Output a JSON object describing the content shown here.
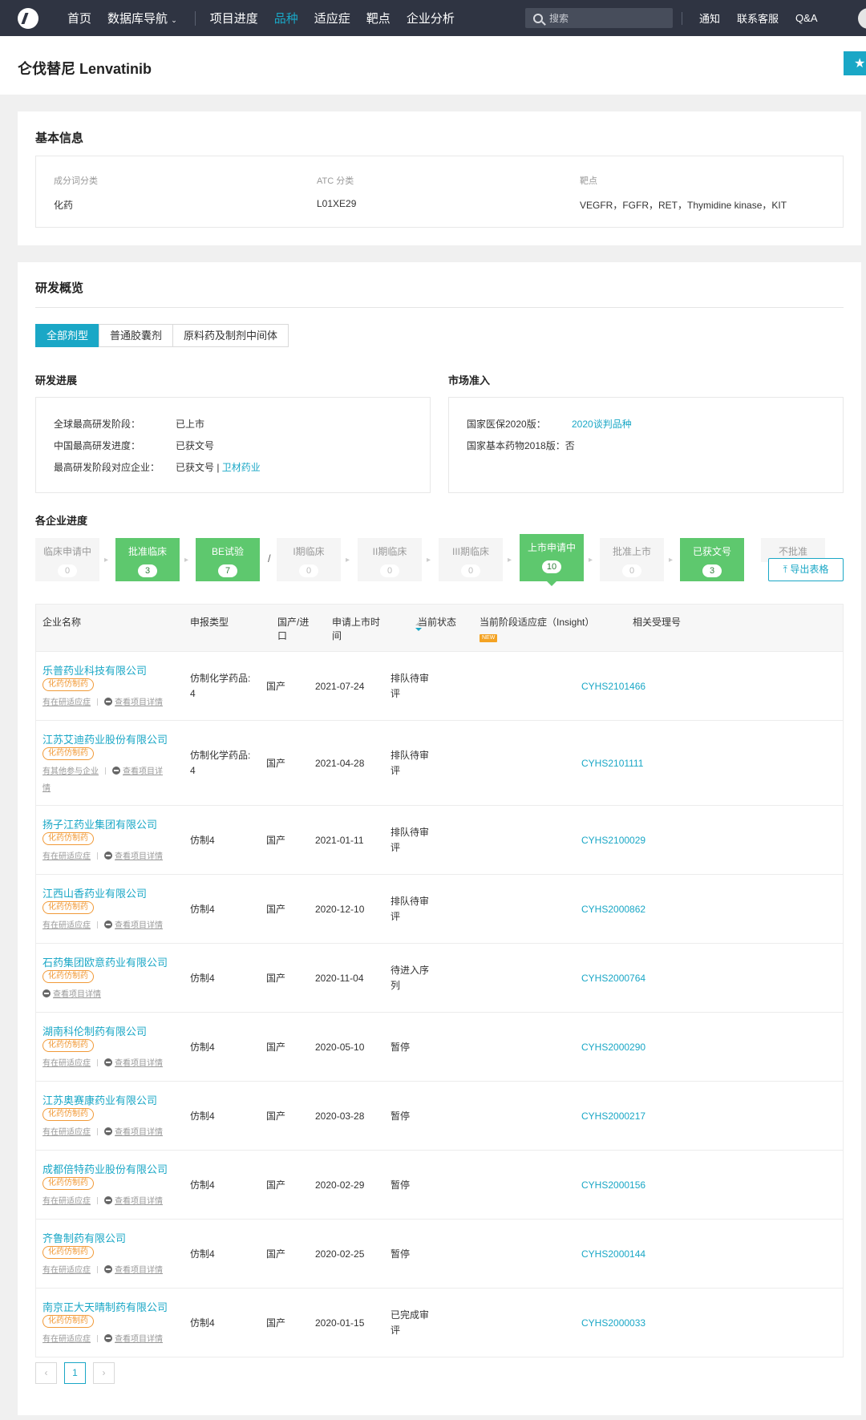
{
  "nav": {
    "items": [
      "首页",
      "数据库导航",
      "项目进度",
      "品种",
      "适应症",
      "靶点",
      "企业分析"
    ],
    "active_index": 3,
    "search_placeholder": "搜索",
    "right": [
      "通知",
      "联系客服",
      "Q&A"
    ]
  },
  "page": {
    "title": "仑伐替尼 Lenvatinib"
  },
  "basic": {
    "title": "基本信息",
    "fields": [
      {
        "label": "成分词分类",
        "value": "化药"
      },
      {
        "label": "ATC 分类",
        "value": "L01XE29"
      },
      {
        "label": "靶点",
        "value": "VEGFR，FGFR，RET，Thymidine kinase，KIT"
      }
    ]
  },
  "overview": {
    "title": "研发概览",
    "tabs": [
      "全部剂型",
      "普通胶囊剂",
      "原料药及制剂中间体"
    ],
    "active_tab": 0,
    "progress": {
      "title": "研发进展",
      "rows": [
        {
          "label": "全球最高研发阶段：",
          "value": "已上市",
          "link": ""
        },
        {
          "label": "中国最高研发进度：",
          "value": "已获文号",
          "link": ""
        },
        {
          "label": "最高研发阶段对应企业：",
          "value": "已获文号 | ",
          "link": "卫材药业"
        }
      ]
    },
    "market": {
      "title": "市场准入",
      "rows": [
        {
          "label": "国家医保2020版：",
          "value": "",
          "link": "2020谈判品种"
        },
        {
          "label": "国家基本药物2018版：",
          "value": "否",
          "link": ""
        }
      ]
    }
  },
  "pipeline": {
    "title": "各企业进度",
    "stages": [
      {
        "label": "临床申请中",
        "count": "0",
        "on": false
      },
      {
        "label": "批准临床",
        "count": "3",
        "on": true
      },
      {
        "label": "BE试验",
        "count": "7",
        "on": true
      },
      {
        "label": "I期临床",
        "count": "0",
        "on": false
      },
      {
        "label": "II期临床",
        "count": "0",
        "on": false
      },
      {
        "label": "III期临床",
        "count": "0",
        "on": false
      },
      {
        "label": "上市申请中",
        "count": "10",
        "on": true
      },
      {
        "label": "批准上市",
        "count": "0",
        "on": false
      },
      {
        "label": "已获文号",
        "count": "3",
        "on": true
      },
      {
        "label": "不批准",
        "count": "",
        "on": false
      }
    ],
    "slash": "/",
    "export_label": "导出表格"
  },
  "table": {
    "headers": [
      "企业名称",
      "申报类型",
      "国产/进口",
      "申请上市时间",
      "当前状态",
      "当前阶段适应症（Insight）",
      "相关受理号"
    ],
    "new_badge": "NEW",
    "rows": [
      {
        "company": "乐普药业科技有限公司",
        "tag": "化药仿制药",
        "link1": "有在研适应症",
        "link2": "查看项目详情",
        "type": "仿制化学药品:\n4",
        "origin": "国产",
        "date": "2021-07-24",
        "status": "排队待审\n评",
        "indication": "",
        "number": "CYHS2101466"
      },
      {
        "company": "江苏艾迪药业股份有限公司",
        "tag": "化药仿制药",
        "link1": "有其他参与企业",
        "link2": "查看项目详",
        "link3": "情",
        "type": "仿制化学药品:\n4",
        "origin": "国产",
        "date": "2021-04-28",
        "status": "排队待审\n评",
        "indication": "",
        "number": "CYHS2101111"
      },
      {
        "company": "扬子江药业集团有限公司",
        "tag": "化药仿制药",
        "link1": "有在研适应症",
        "link2": "查看项目详情",
        "type": "仿制4",
        "origin": "国产",
        "date": "2021-01-11",
        "status": "排队待审\n评",
        "indication": "",
        "number": "CYHS2100029"
      },
      {
        "company": "江西山香药业有限公司",
        "tag": "化药仿制药",
        "link1": "有在研适应症",
        "link2": "查看项目详情",
        "type": "仿制4",
        "origin": "国产",
        "date": "2020-12-10",
        "status": "排队待审\n评",
        "indication": "",
        "number": "CYHS2000862"
      },
      {
        "company": "石药集团欧意药业有限公司",
        "tag": "化药仿制药",
        "link1": "",
        "link2": "查看项目详情",
        "type": "仿制4",
        "origin": "国产",
        "date": "2020-11-04",
        "status": "待进入序\n列",
        "indication": "",
        "number": "CYHS2000764"
      },
      {
        "company": "湖南科伦制药有限公司",
        "tag": "化药仿制药",
        "link1": "有在研适应症",
        "link2": "查看项目详情",
        "type": "仿制4",
        "origin": "国产",
        "date": "2020-05-10",
        "status": "暂停",
        "indication": "",
        "number": "CYHS2000290"
      },
      {
        "company": "江苏奥赛康药业有限公司",
        "tag": "化药仿制药",
        "link1": "有在研适应症",
        "link2": "查看项目详情",
        "type": "仿制4",
        "origin": "国产",
        "date": "2020-03-28",
        "status": "暂停",
        "indication": "",
        "number": "CYHS2000217"
      },
      {
        "company": "成都倍特药业股份有限公司",
        "tag": "化药仿制药",
        "link1": "有在研适应症",
        "link2": "查看项目详情",
        "type": "仿制4",
        "origin": "国产",
        "date": "2020-02-29",
        "status": "暂停",
        "indication": "",
        "number": "CYHS2000156"
      },
      {
        "company": "齐鲁制药有限公司",
        "tag": "化药仿制药",
        "link1": "有在研适应症",
        "link2": "查看项目详情",
        "type": "仿制4",
        "origin": "国产",
        "date": "2020-02-25",
        "status": "暂停",
        "indication": "",
        "number": "CYHS2000144"
      },
      {
        "company": "南京正大天晴制药有限公司",
        "tag": "化药仿制药",
        "link1": "有在研适应症",
        "link2": "查看项目详情",
        "type": "仿制4",
        "origin": "国产",
        "date": "2020-01-15",
        "status": "已完成审\n评",
        "indication": "",
        "number": "CYHS2000033"
      }
    ]
  },
  "pagination": {
    "prev": "‹",
    "current": "1",
    "next": "›"
  },
  "colors": {
    "accent": "#1aa7c6",
    "green": "#5ec86e",
    "orange": "#f19a38",
    "nav_bg": "#2f3442"
  }
}
